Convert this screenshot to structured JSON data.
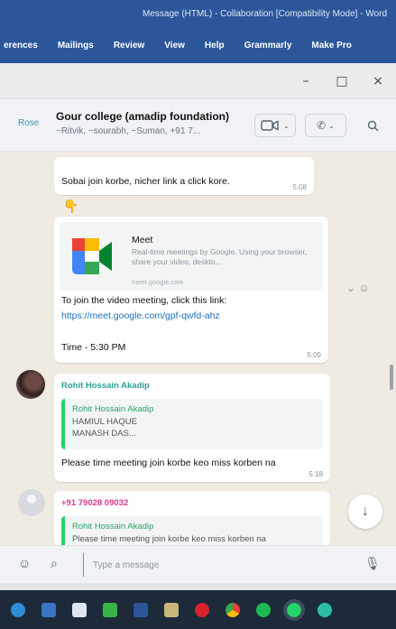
{
  "word": {
    "title": "Message (HTML) - Collaboration [Compatibility Mode] - Word",
    "ribbon": [
      "Mailings",
      "Review",
      "View",
      "Help",
      "Grammarly",
      "Make Pro"
    ],
    "ribbon_first": "erences"
  },
  "window": {
    "minimize": "–",
    "maximize": "□",
    "close": "×"
  },
  "header": {
    "back": "Rose",
    "group_name": "Gour college (amadip foundation)",
    "members": "~Ritvik, ~sourabh, ~Suman, +91 7...",
    "video_icon": "video-camera-icon",
    "call_icon": "phone-icon",
    "search_icon": "search-icon"
  },
  "messages": {
    "m1": {
      "text": "Sobai join korbe, nicher link a click kore.",
      "time": "5:08"
    },
    "m2": {
      "link_title": "Meet",
      "link_desc": "Real-time meetings by Google. Using your browser, share your video, deskto...",
      "link_domain": "meet.google.com",
      "join_text": "To join the video meeting, click this link:",
      "url": "https://meet.google.com/gpf-qwfd-ahz",
      "time_text": "Time - 5:30 PM",
      "time": "5:09"
    },
    "m3": {
      "sender": "Rohit Hossain Akadip",
      "quote_author": "Rohit Hossain Akadip",
      "quote_line1": "HAMIUL HAQUE",
      "quote_line2": "MANASH DAS...",
      "text": "Please time meeting join korbe keo miss korben na",
      "time": "5:18"
    },
    "m4": {
      "sender": "+91 79028 09032",
      "quote_author": "Rohit Hossain Akadip",
      "quote_line": "Please time meeting join korbe keo miss korben na"
    }
  },
  "compose": {
    "placeholder": "Type a message"
  },
  "colors": {
    "word_blue": "#2b579a",
    "whatsapp_green": "#25d366",
    "link": "#1b6fb8"
  }
}
